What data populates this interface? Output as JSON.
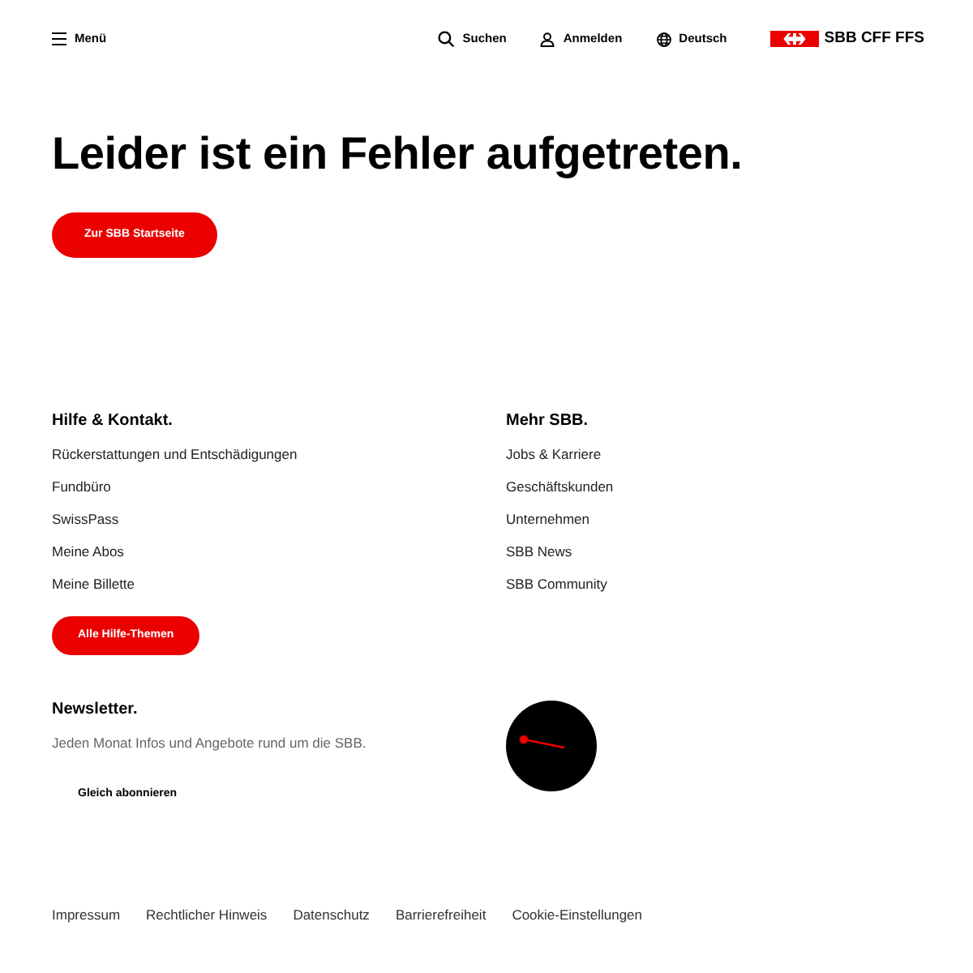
{
  "header": {
    "menu": "Menü",
    "search": "Suchen",
    "login": "Anmelden",
    "language": "Deutsch",
    "logo": "SBB CFF FFS"
  },
  "main": {
    "title": "Leider ist ein Fehler aufgetreten.",
    "button": "Zur SBB Startseite"
  },
  "footer": {
    "columns": [
      {
        "title": "Hilfe & Kontakt.",
        "links": [
          "Rückerstattungen und Entschädigungen",
          "Fundbüro",
          "SwissPass",
          "Meine Abos",
          "Meine Billette"
        ],
        "button": "Alle Hilfe-Themen"
      },
      {
        "title": "Mehr SBB.",
        "links": [
          "Jobs & Karriere",
          "Geschäftskunden",
          "Unternehmen",
          "SBB News",
          "SBB Community"
        ]
      }
    ],
    "newsletter": {
      "title": "Newsletter.",
      "text": "Jeden Monat Infos und Angebote rund um die SBB.",
      "link": "Gleich abonnieren"
    },
    "legal_links": [
      "Impressum",
      "Rechtlicher Hinweis",
      "Datenschutz",
      "Barrierefreiheit",
      "Cookie-Einstellungen"
    ]
  }
}
